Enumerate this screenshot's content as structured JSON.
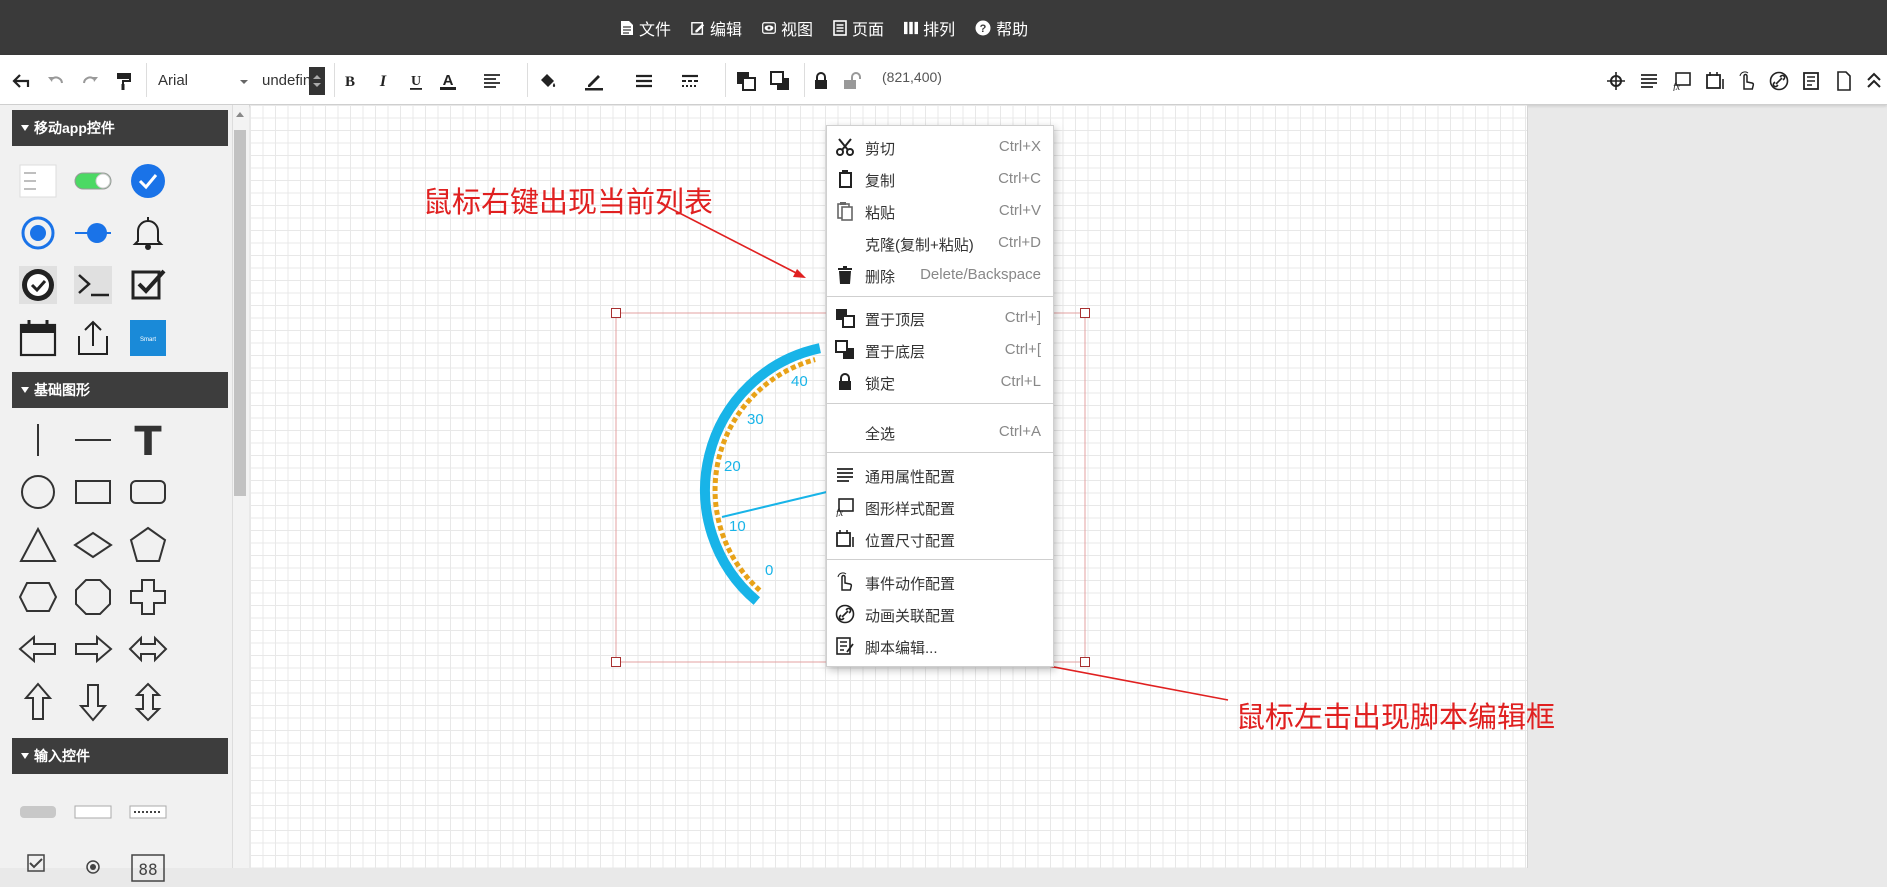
{
  "menubar": {
    "items": [
      {
        "label": "文件",
        "icon": "file-icon"
      },
      {
        "label": "编辑",
        "icon": "edit-icon"
      },
      {
        "label": "视图",
        "icon": "eye-icon"
      },
      {
        "label": "页面",
        "icon": "page-icon"
      },
      {
        "label": "排列",
        "icon": "arrange-icon"
      },
      {
        "label": "帮助",
        "icon": "help-icon"
      }
    ]
  },
  "toolbar": {
    "font_family": "Arial",
    "font_size": "undefined",
    "coordinates": "(821,400)"
  },
  "sidebar": {
    "sections": [
      {
        "title": "移动app控件"
      },
      {
        "title": "基础图形"
      },
      {
        "title": "输入控件"
      }
    ],
    "mini_button_text": "Smart"
  },
  "annotations": {
    "right_click_note": "鼠标右键出现当前列表",
    "left_click_note": "鼠标左击出现脚本编辑框"
  },
  "gauge": {
    "ticks": [
      "0",
      "10",
      "20",
      "30",
      "40"
    ],
    "colors": {
      "outer_arc": "#18b4e8",
      "inner_arc": "#e8a218",
      "needle": "#18b4e8",
      "tick_label": "#18b4e8"
    }
  },
  "context_menu": {
    "items": [
      {
        "label": "剪切",
        "shortcut": "Ctrl+X",
        "icon": "scissors-icon"
      },
      {
        "label": "复制",
        "shortcut": "Ctrl+C",
        "icon": "copy-icon"
      },
      {
        "label": "粘贴",
        "shortcut": "Ctrl+V",
        "icon": "paste-icon"
      },
      {
        "label": "克隆(复制+粘贴)",
        "shortcut": "Ctrl+D",
        "icon": ""
      },
      {
        "label": "删除",
        "shortcut": "Delete/Backspace",
        "icon": "trash-icon"
      },
      {
        "label": "置于顶层",
        "shortcut": "Ctrl+]",
        "icon": "bring-to-front-icon"
      },
      {
        "label": "置于底层",
        "shortcut": "Ctrl+[",
        "icon": "send-to-back-icon"
      },
      {
        "label": "锁定",
        "shortcut": "Ctrl+L",
        "icon": "lock-icon"
      },
      {
        "label": "全选",
        "shortcut": "Ctrl+A",
        "icon": ""
      },
      {
        "label": "通用属性配置",
        "shortcut": "",
        "icon": "align-lines-icon"
      },
      {
        "label": "图形样式配置",
        "shortcut": "",
        "icon": "style-fx-icon"
      },
      {
        "label": "位置尺寸配置",
        "shortcut": "",
        "icon": "position-size-icon"
      },
      {
        "label": "事件动作配置",
        "shortcut": "",
        "icon": "hand-pointer-icon"
      },
      {
        "label": "动画关联配置",
        "shortcut": "",
        "icon": "link-icon"
      },
      {
        "label": "脚本编辑...",
        "shortcut": "",
        "icon": "script-edit-icon"
      }
    ]
  },
  "colors": {
    "menubar_bg": "#3a3a3a",
    "annotation_red": "#e02020",
    "accent_blue": "#1a73e8"
  }
}
